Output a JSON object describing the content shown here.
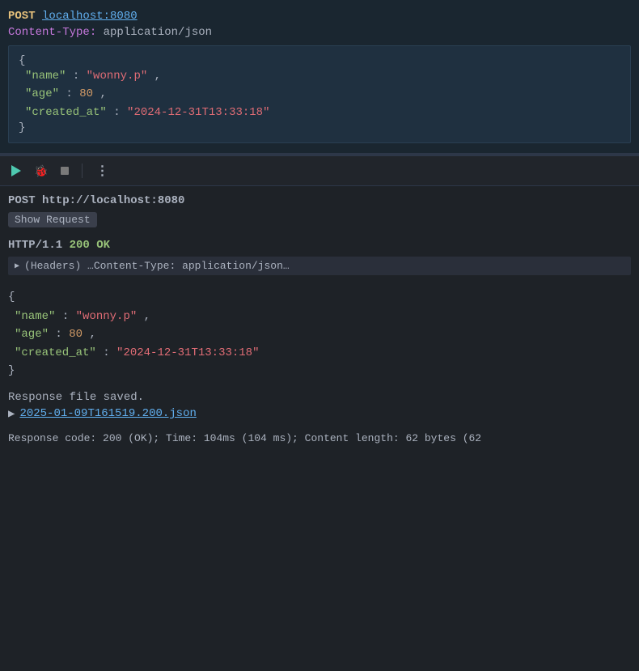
{
  "top": {
    "method": "POST",
    "url": "localhost:8080",
    "content_type_key": "Content-Type:",
    "content_type_value": " application/json",
    "json": {
      "brace_open": "{",
      "line1_key": "\"name\"",
      "line1_colon": ": ",
      "line1_value": "\"wonny.p\"",
      "line1_comma": ",",
      "line2_key": "\"age\"",
      "line2_colon": ": ",
      "line2_value": "80",
      "line2_comma": ",",
      "line3_key": "\"created_at\"",
      "line3_colon": ": ",
      "line3_value": "\"2024-12-31T13:33:18\"",
      "brace_close": "}"
    }
  },
  "toolbar": {
    "play_label": "run",
    "bug_label": "debug",
    "stop_label": "stop",
    "more_label": "more options",
    "separator_label": "divider"
  },
  "bottom": {
    "post_line": "POST http://localhost:8080",
    "show_request_label": "Show Request",
    "http_status": "HTTP/1.1 200 OK",
    "headers_text": "(Headers) …Content-Type: application/json…",
    "json": {
      "brace_open": "{",
      "line1_key": "\"name\"",
      "line1_colon": ": ",
      "line1_value": "\"wonny.p\"",
      "line1_comma": ",",
      "line2_key": "\"age\"",
      "line2_colon": ": ",
      "line2_value": "80",
      "line2_comma": ",",
      "line3_key": "\"created_at\"",
      "line3_colon": ": ",
      "line3_value": "\"2024-12-31T13:33:18\"",
      "brace_close": "}"
    },
    "response_file_saved": "Response file saved.",
    "file_link": "2025-01-09T161519.200.json",
    "response_code": "Response code: 200 (OK); Time: 104ms (104 ms); Content length: 62 bytes (62"
  }
}
